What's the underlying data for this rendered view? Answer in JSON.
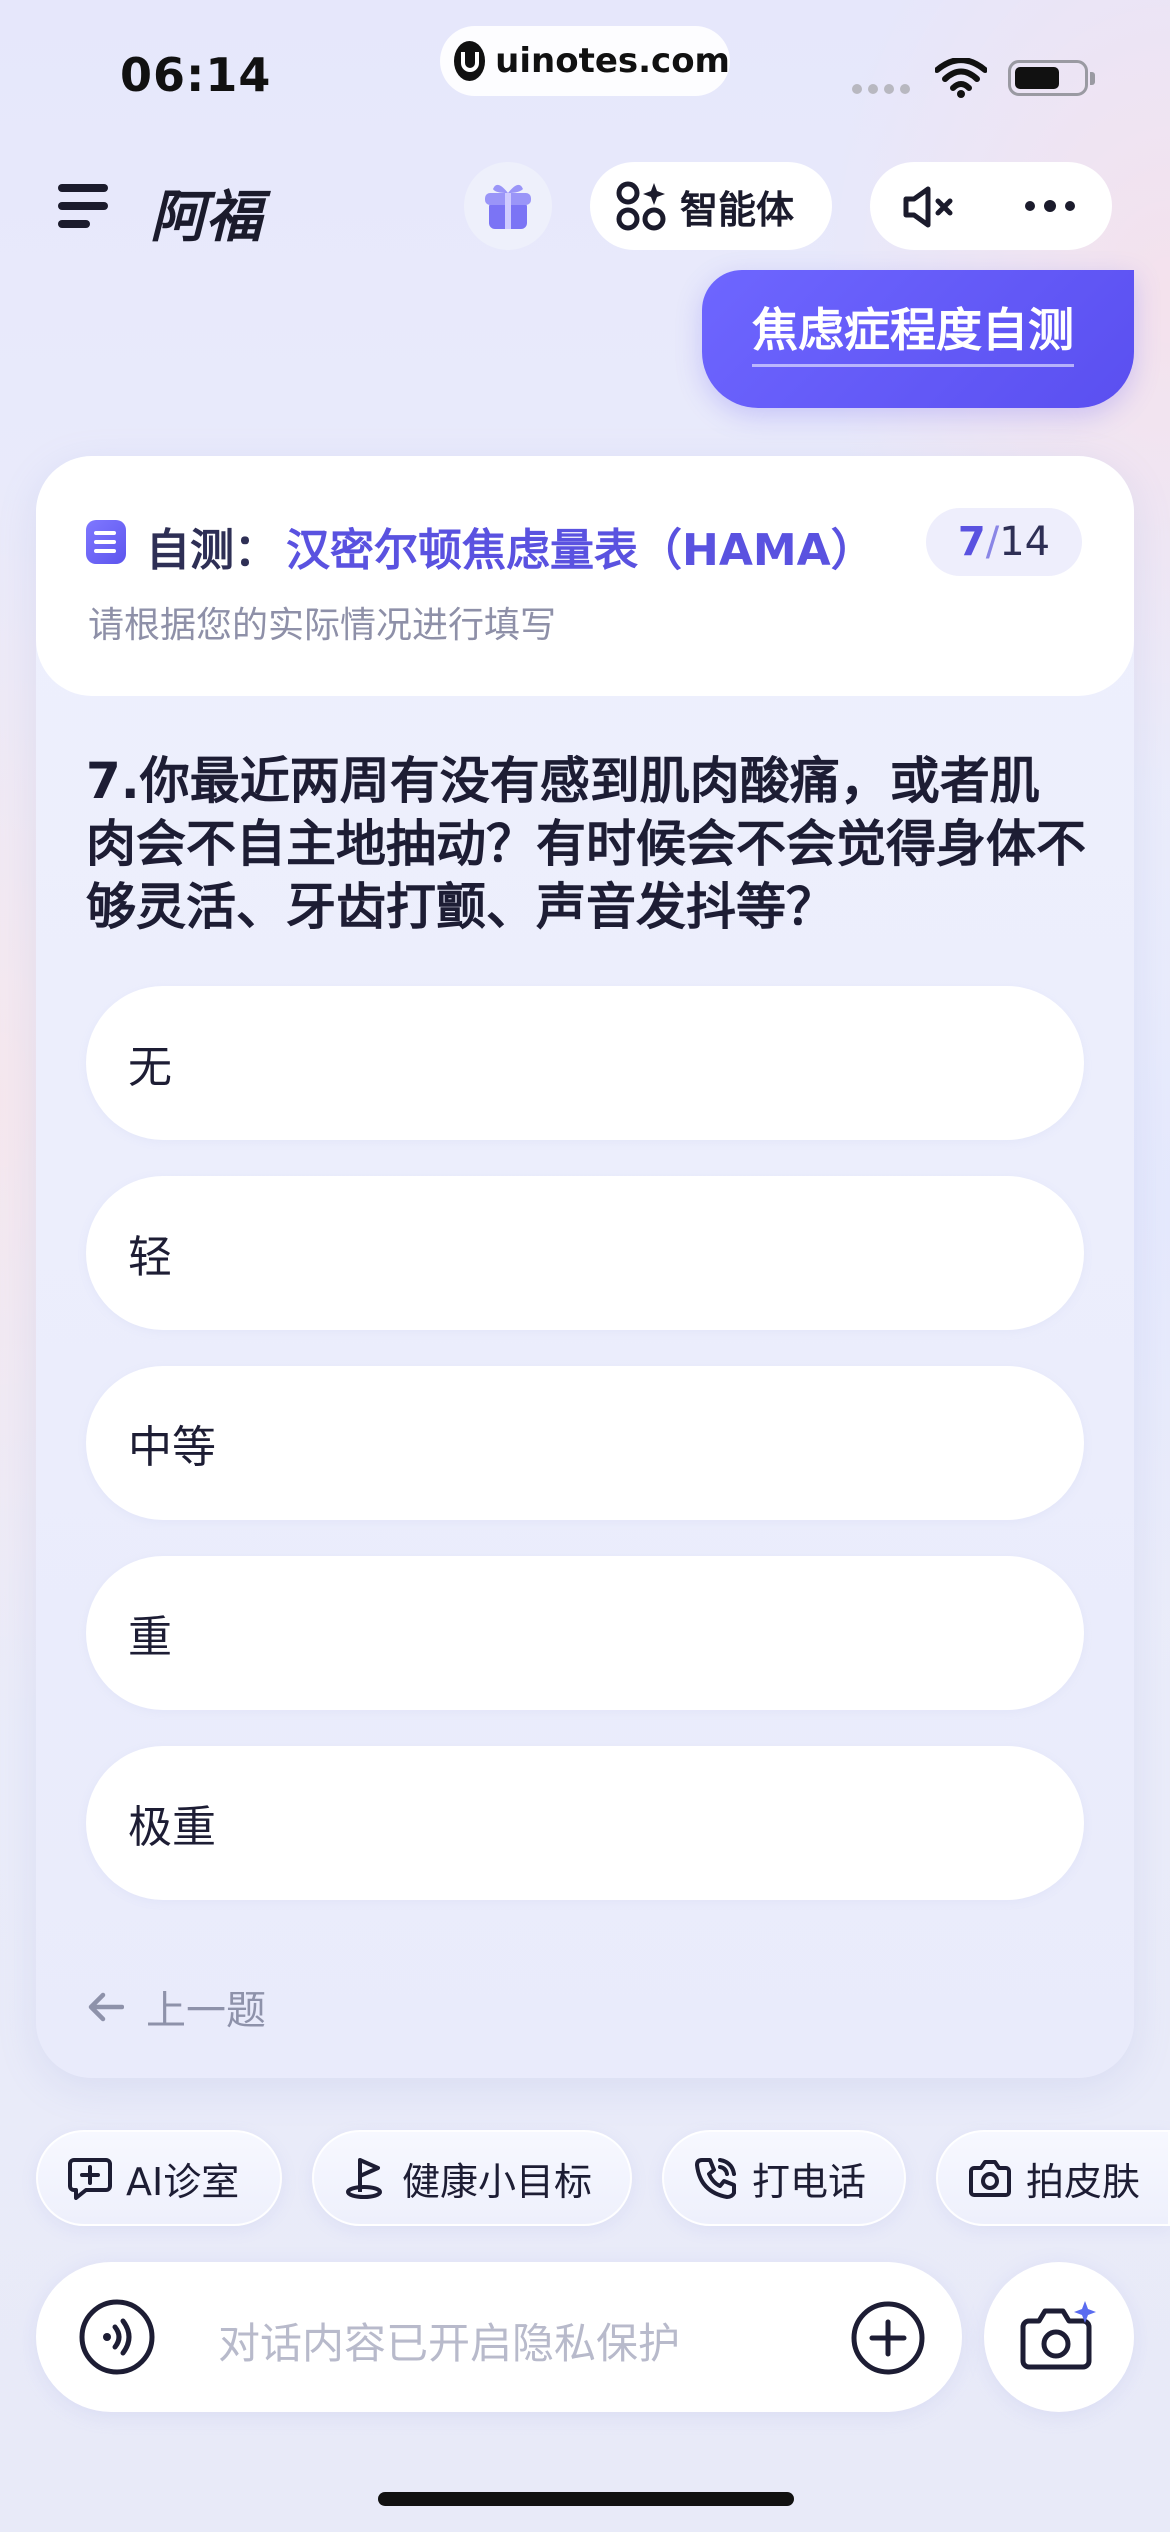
{
  "status_bar": {
    "time": "06:14",
    "url": "uinotes.com"
  },
  "header": {
    "title": "阿福",
    "agent_label": "智能体",
    "icons": [
      "menu-icon",
      "gift-icon",
      "agents-icon",
      "speaker-mute-icon",
      "more-icon"
    ]
  },
  "user_message": "焦虑症程度自测",
  "quiz": {
    "title_prefix": "自测：",
    "title_name": "汉密尔顿焦虑量表（HAMA）",
    "progress_current": "7",
    "progress_separator": "/",
    "progress_total": "14",
    "subtitle": "请根据您的实际情况进行填写",
    "question": "7.你最近两周有没有感到肌肉酸痛，或者肌肉会不自主地抽动？有时候会不会觉得身体不够灵活、牙齿打颤、声音发抖等？",
    "options": [
      "无",
      "轻",
      "中等",
      "重",
      "极重"
    ],
    "prev_label": "上一题"
  },
  "quick_actions": [
    {
      "label": "AI诊室",
      "icon": "chat-plus-icon"
    },
    {
      "label": "健康小目标",
      "icon": "flag-icon"
    },
    {
      "label": "打电话",
      "icon": "phone-icon"
    },
    {
      "label": "拍皮肤",
      "icon": "camera-icon"
    }
  ],
  "input": {
    "placeholder": "对话内容已开启隐私保护"
  },
  "colors": {
    "accent": "#5a52e0",
    "bubble": "#6259f3",
    "text_dark": "#1d1d34",
    "text_muted": "#8e92aa"
  }
}
